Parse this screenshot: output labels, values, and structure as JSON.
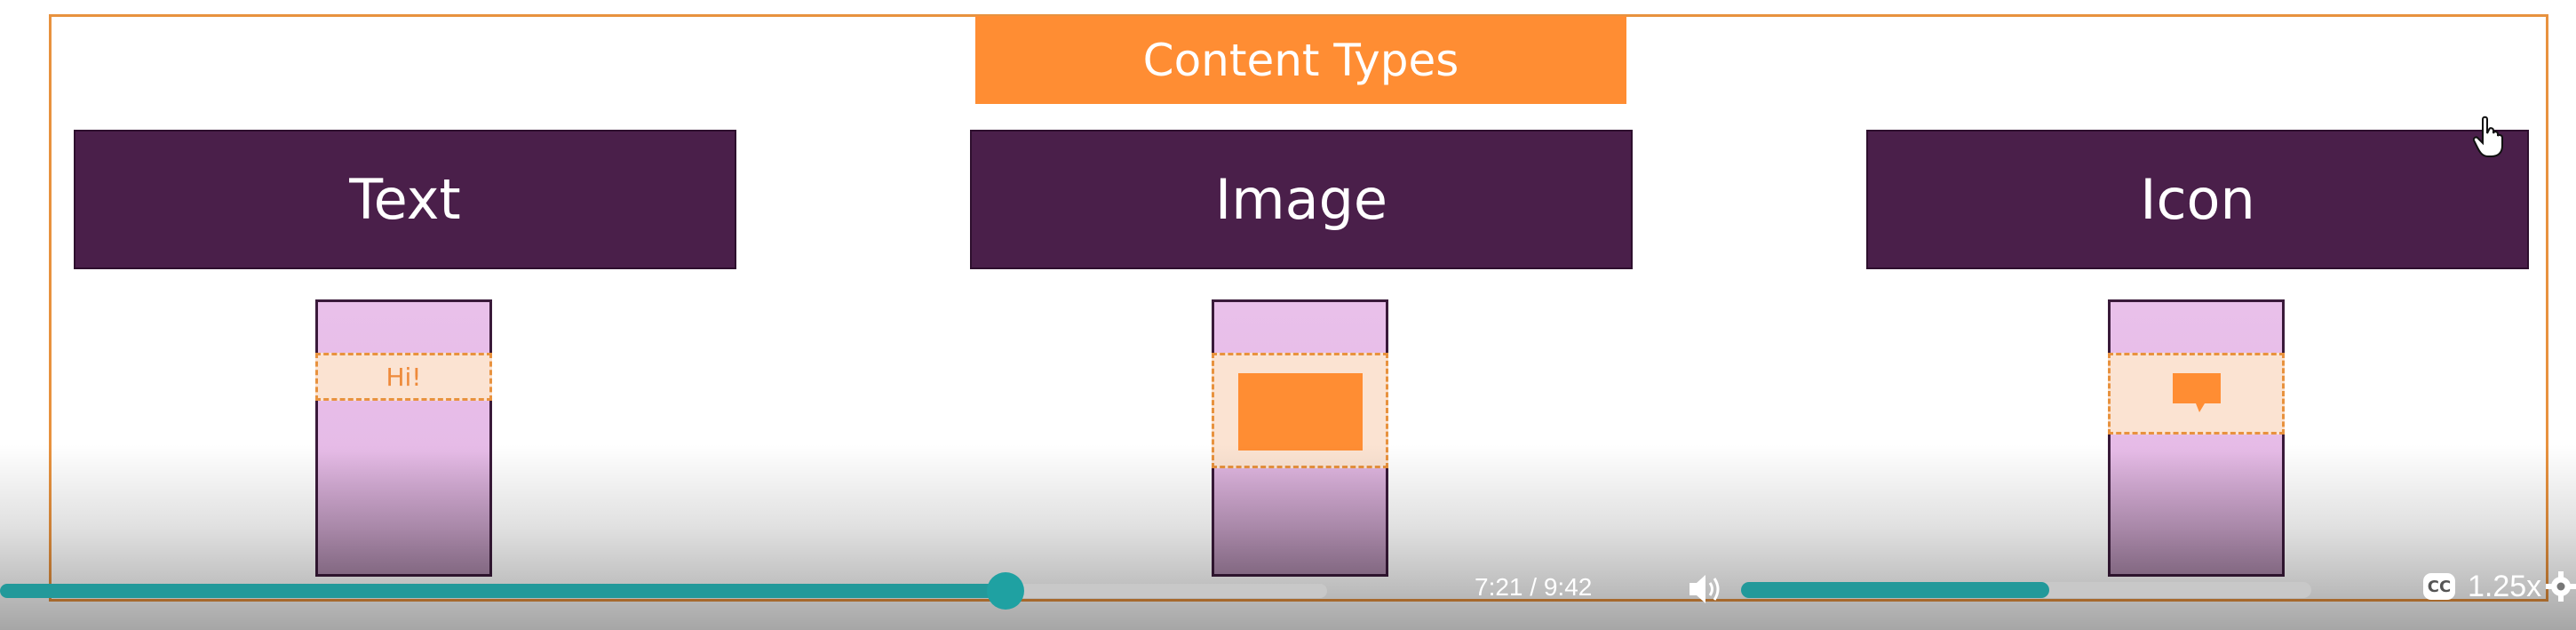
{
  "slide": {
    "title": "Content Types",
    "columns": [
      {
        "label": "Text",
        "sample_text": "Hi!"
      },
      {
        "label": "Image"
      },
      {
        "label": "Icon",
        "icon": "speech-bubble-icon"
      }
    ]
  },
  "player": {
    "current_time": "7:21",
    "separator": "/",
    "duration": "9:42",
    "progress_fraction": 0.758,
    "volume_fraction": 0.54,
    "speed": "1.25x",
    "cc_label": "CC",
    "icons": [
      "volume-icon",
      "closed-captions-icon",
      "gear-icon"
    ]
  },
  "colors": {
    "accent": "#ff8d33",
    "header": "#4a1f4a",
    "progress": "#22999a"
  }
}
